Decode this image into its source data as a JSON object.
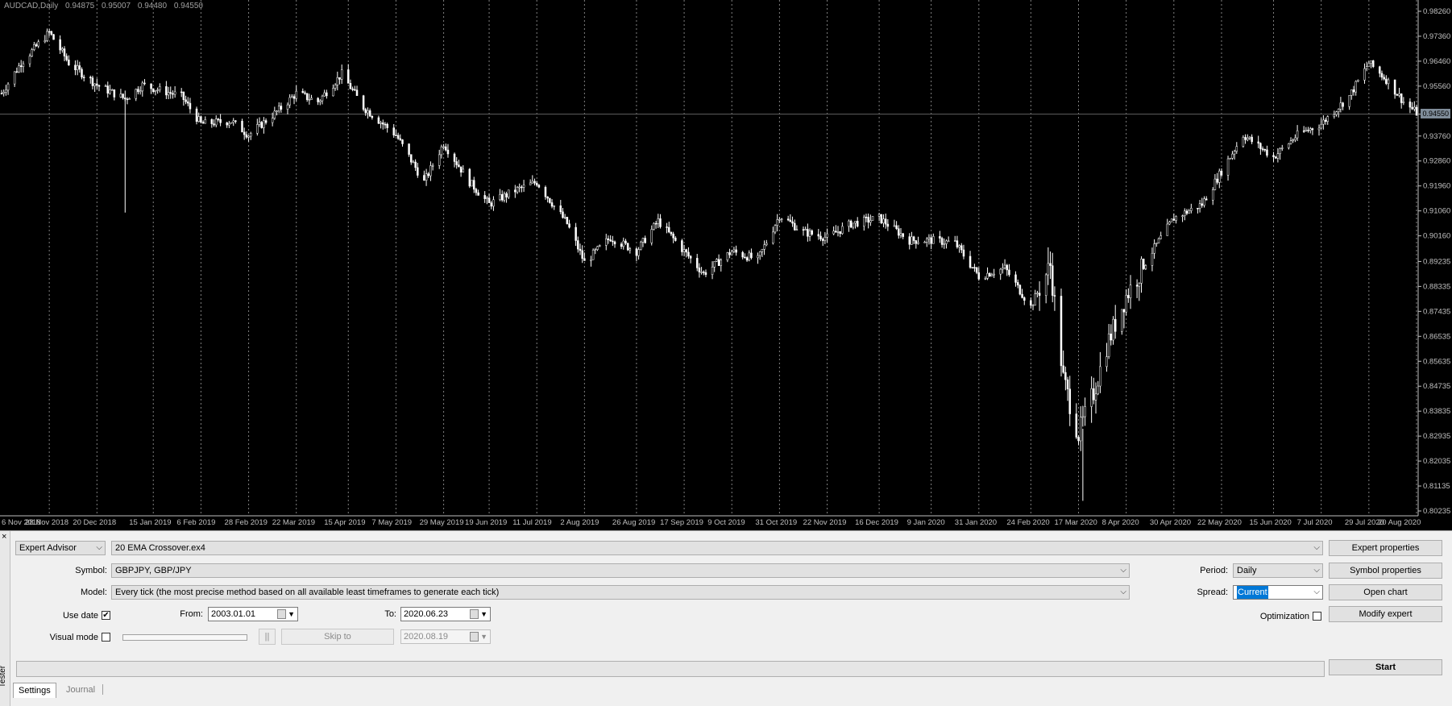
{
  "chart": {
    "symbol": "AUDCAD,Daily",
    "ohlc": [
      "0.94875",
      "0.95007",
      "0.94480",
      "0.94550"
    ],
    "current_price": "0.94550",
    "price_labels": [
      "0.98260",
      "0.97360",
      "0.96460",
      "0.95560",
      "0.94550",
      "0.93760",
      "0.92860",
      "0.91960",
      "0.91060",
      "0.90160",
      "0.89235",
      "0.88335",
      "0.87435",
      "0.86535",
      "0.85635",
      "0.84735",
      "0.83835",
      "0.82935",
      "0.82035",
      "0.81135",
      "0.80235"
    ],
    "date_labels": [
      "6 Nov 2018",
      "28 Nov 2018",
      "20 Dec 2018",
      "15 Jan 2019",
      "6 Feb 2019",
      "28 Feb 2019",
      "22 Mar 2019",
      "15 Apr 2019",
      "7 May 2019",
      "29 May 2019",
      "19 Jun 2019",
      "11 Jul 2019",
      "2 Aug 2019",
      "26 Aug 2019",
      "17 Sep 2019",
      "9 Oct 2019",
      "31 Oct 2019",
      "22 Nov 2019",
      "16 Dec 2019",
      "9 Jan 2020",
      "31 Jan 2020",
      "24 Feb 2020",
      "17 Mar 2020",
      "8 Apr 2020",
      "30 Apr 2020",
      "22 May 2020",
      "15 Jun 2020",
      "7 Jul 2020",
      "29 Jul 2020",
      "20 Aug 2020"
    ],
    "price_keypoints": [
      [
        "6 Nov 2018",
        0.953
      ],
      [
        "15 Nov 2018",
        0.964
      ],
      [
        "28 Nov 2018",
        0.975
      ],
      [
        "7 Dec 2018",
        0.964
      ],
      [
        "20 Dec 2018",
        0.956
      ],
      [
        "2 Jan 2019",
        0.951
      ],
      [
        "10 Jan 2019",
        0.956
      ],
      [
        "28 Jan 2019",
        0.952
      ],
      [
        "6 Feb 2019",
        0.942
      ],
      [
        "20 Feb 2019",
        0.943
      ],
      [
        "28 Feb 2019",
        0.938
      ],
      [
        "14 Mar 2019",
        0.947
      ],
      [
        "22 Mar 2019",
        0.953
      ],
      [
        "1 Apr 2019",
        0.95
      ],
      [
        "12 Apr 2019",
        0.96
      ],
      [
        "22 Apr 2019",
        0.948
      ],
      [
        "7 May 2019",
        0.938
      ],
      [
        "20 May 2019",
        0.921
      ],
      [
        "29 May 2019",
        0.935
      ],
      [
        "10 Jun 2019",
        0.921
      ],
      [
        "19 Jun 2019",
        0.913
      ],
      [
        "1 Jul 2019",
        0.918
      ],
      [
        "11 Jul 2019",
        0.921
      ],
      [
        "25 Jul 2019",
        0.906
      ],
      [
        "2 Aug 2019",
        0.892
      ],
      [
        "14 Aug 2019",
        0.901
      ],
      [
        "26 Aug 2019",
        0.896
      ],
      [
        "5 Sep 2019",
        0.907
      ],
      [
        "17 Sep 2019",
        0.896
      ],
      [
        "26 Sep 2019",
        0.888
      ],
      [
        "9 Oct 2019",
        0.896
      ],
      [
        "21 Oct 2019",
        0.893
      ],
      [
        "31 Oct 2019",
        0.909
      ],
      [
        "11 Nov 2019",
        0.903
      ],
      [
        "22 Nov 2019",
        0.901
      ],
      [
        "3 Dec 2019",
        0.906
      ],
      [
        "16 Dec 2019",
        0.908
      ],
      [
        "30 Dec 2019",
        0.9
      ],
      [
        "9 Jan 2020",
        0.9
      ],
      [
        "20 Jan 2020",
        0.899
      ],
      [
        "31 Jan 2020",
        0.887
      ],
      [
        "12 Feb 2020",
        0.89
      ],
      [
        "24 Feb 2020",
        0.876
      ],
      [
        "4 Mar 2020",
        0.891
      ],
      [
        "10 Mar 2020",
        0.85
      ],
      [
        "17 Mar 2020",
        0.83
      ],
      [
        "24 Mar 2020",
        0.845
      ],
      [
        "30 Mar 2020",
        0.862
      ],
      [
        "8 Apr 2020",
        0.88
      ],
      [
        "20 Apr 2020",
        0.896
      ],
      [
        "30 Apr 2020",
        0.908
      ],
      [
        "13 May 2020",
        0.913
      ],
      [
        "22 May 2020",
        0.925
      ],
      [
        "1 Jun 2020",
        0.938
      ],
      [
        "15 Jun 2020",
        0.93
      ],
      [
        "26 Jun 2020",
        0.938
      ],
      [
        "7 Jul 2020",
        0.942
      ],
      [
        "20 Jul 2020",
        0.952
      ],
      [
        "29 Jul 2020",
        0.964
      ],
      [
        "6 Aug 2020",
        0.958
      ],
      [
        "14 Aug 2020",
        0.95
      ],
      [
        "20 Aug 2020",
        0.946
      ]
    ],
    "colors": {
      "background": "#000000",
      "candles": "#ffffff",
      "grid": "#808080",
      "axis_text": "#c0c0c0"
    }
  },
  "tester": {
    "side_label": "Tester",
    "close_glyph": "×",
    "mode_select": "Expert Advisor",
    "expert_file": "20 EMA Crossover.ex4",
    "symbol_label": "Symbol:",
    "symbol_value": "GBPJPY, GBP/JPY",
    "model_label": "Model:",
    "model_value": "Every tick (the most precise method based on all available least timeframes to generate each tick)",
    "use_date_label": "Use date",
    "use_date_checked": "✔",
    "from_label": "From:",
    "from_value": "2003.01.01",
    "to_label": "To:",
    "to_value": "2020.06.23",
    "visual_mode_label": "Visual mode",
    "pause_glyph": "||",
    "skip_to_label": "Skip to",
    "skip_date_value": "2020.08.19",
    "period_label": "Period:",
    "period_value": "Daily",
    "spread_label": "Spread:",
    "spread_value": "Current",
    "optimization_label": "Optimization",
    "buttons": {
      "expert_properties": "Expert properties",
      "symbol_properties": "Symbol properties",
      "open_chart": "Open chart",
      "modify_expert": "Modify expert",
      "start": "Start"
    },
    "tabs": [
      "Settings",
      "Journal"
    ],
    "chevron": "⌵"
  }
}
